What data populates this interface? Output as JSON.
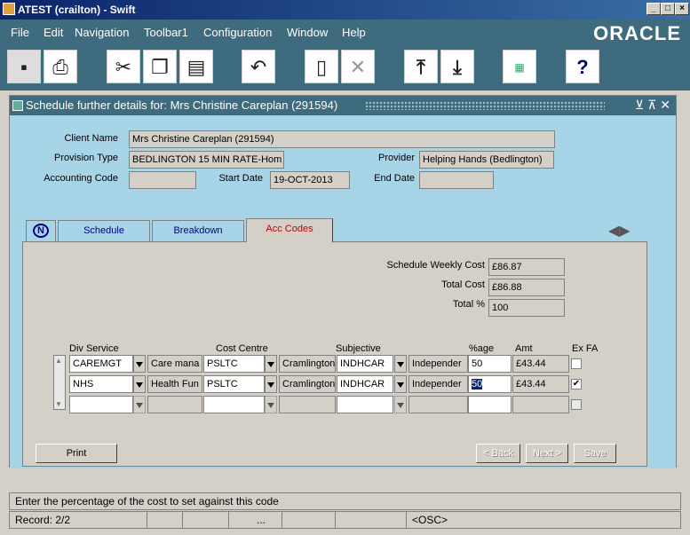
{
  "window": {
    "title": "ATEST (crailton) - Swift",
    "controls": [
      "_",
      "□",
      "×"
    ]
  },
  "menu": {
    "items": [
      "File",
      "Edit",
      "Navigation",
      "Toolbar1",
      "Configuration",
      "Window",
      "Help"
    ],
    "brand": "ORACLE"
  },
  "toolbar": {
    "icons": [
      "save-icon",
      "print-icon",
      "cut-icon",
      "copy-icon",
      "paste-icon",
      "undo-icon",
      "new-record-icon",
      "delete-icon",
      "first-record-icon",
      "last-record-icon",
      "list-of-values-icon",
      "help-icon"
    ]
  },
  "form": {
    "title": "Schedule further details for: Mrs Christine Careplan (291594)",
    "client_name_label": "Client Name",
    "client_name": "Mrs Christine Careplan (291594)",
    "provision_type_label": "Provision Type",
    "provision_type": "BEDLINGTON 15 MIN RATE-Hom",
    "provider_label": "Provider",
    "provider": "Helping Hands (Bedlington)",
    "accounting_code_label": "Accounting Code",
    "accounting_code": "",
    "start_date_label": "Start Date",
    "start_date": "19-OCT-2013",
    "end_date_label": "End Date",
    "end_date": ""
  },
  "tabs": {
    "n_label": "N",
    "schedule": "Schedule",
    "breakdown": "Breakdown",
    "acc_codes": "Acc Codes"
  },
  "summary": {
    "weekly_cost_label": "Schedule Weekly Cost",
    "weekly_cost": "£86.87",
    "total_cost_label": "Total Cost",
    "total_cost": "£86.88",
    "total_pct_label": "Total %",
    "total_pct": "100"
  },
  "grid": {
    "headers": {
      "div_service": "Div Service",
      "cost_centre": "Cost Centre",
      "subjective": "Subjective",
      "pct": "%age",
      "amt": "Amt",
      "exfa": "Ex FA"
    },
    "rows": [
      {
        "div": "CAREMGT",
        "div_desc": "Care mana",
        "cc": "PSLTC",
        "cc_desc": "Cramlington",
        "subj": "INDHCAR",
        "subj_desc": "Independer",
        "pct": "50",
        "amt": "£43.44",
        "exfa": false
      },
      {
        "div": "NHS",
        "div_desc": "Health Fun",
        "cc": "PSLTC",
        "cc_desc": "Cramlington",
        "subj": "INDHCAR",
        "subj_desc": "Independer",
        "pct": "50",
        "amt": "£43.44",
        "exfa": true
      }
    ]
  },
  "buttons": {
    "print": "Print",
    "back": "< Back",
    "next": "Next >",
    "save": "Save"
  },
  "status": {
    "message": "Enter the percentage of the cost to set against this code",
    "record": "Record: 2/2",
    "ellipsis": "...",
    "osc": "<OSC>"
  }
}
